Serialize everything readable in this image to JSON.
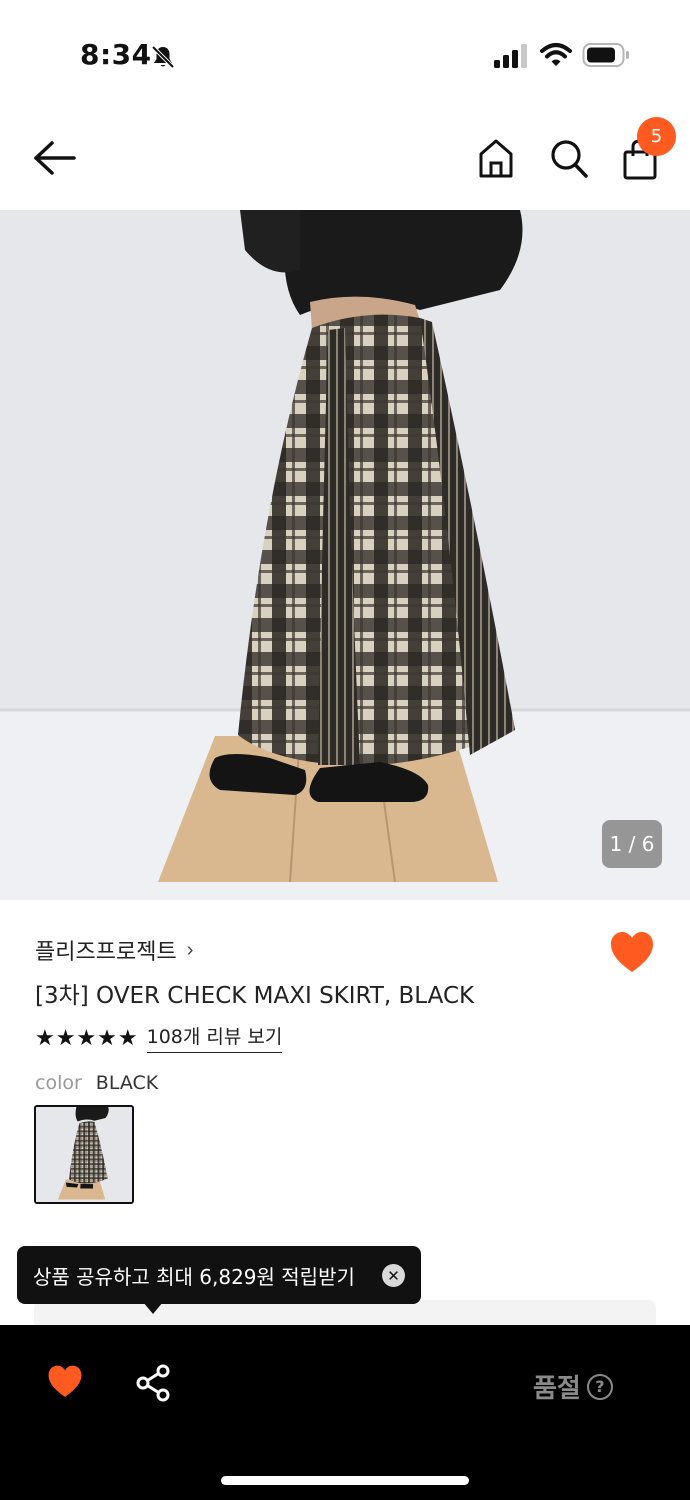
{
  "status_bar": {
    "time": "8:34",
    "icons": [
      "bell-slash-icon",
      "cellular-signal-icon",
      "wifi-icon",
      "battery-icon"
    ]
  },
  "nav": {
    "icons": [
      "back-arrow-icon",
      "home-icon",
      "search-icon",
      "shopping-bag-icon"
    ],
    "cart_count": "5"
  },
  "gallery": {
    "counter": "1 / 6"
  },
  "product": {
    "brand": "플리즈프로젝트",
    "brand_chevron": "›",
    "title": "[3차] OVER CHECK MAXI SKIRT, BLACK",
    "rating_stars": 5,
    "stars_text": "★★★★★",
    "review_link": "108개 리뷰 보기",
    "color_label": "color",
    "color_value": "BLACK"
  },
  "tooltip": {
    "text": "상품 공유하고 최대 6,829원 적립받기",
    "close_glyph": "✕"
  },
  "bottom_bar": {
    "status_label": "품절",
    "help_glyph": "?"
  },
  "colors": {
    "accent": "#ff5a1f",
    "bottom_bar_bg": "#000000",
    "disabled_text": "#8a8a8a"
  }
}
